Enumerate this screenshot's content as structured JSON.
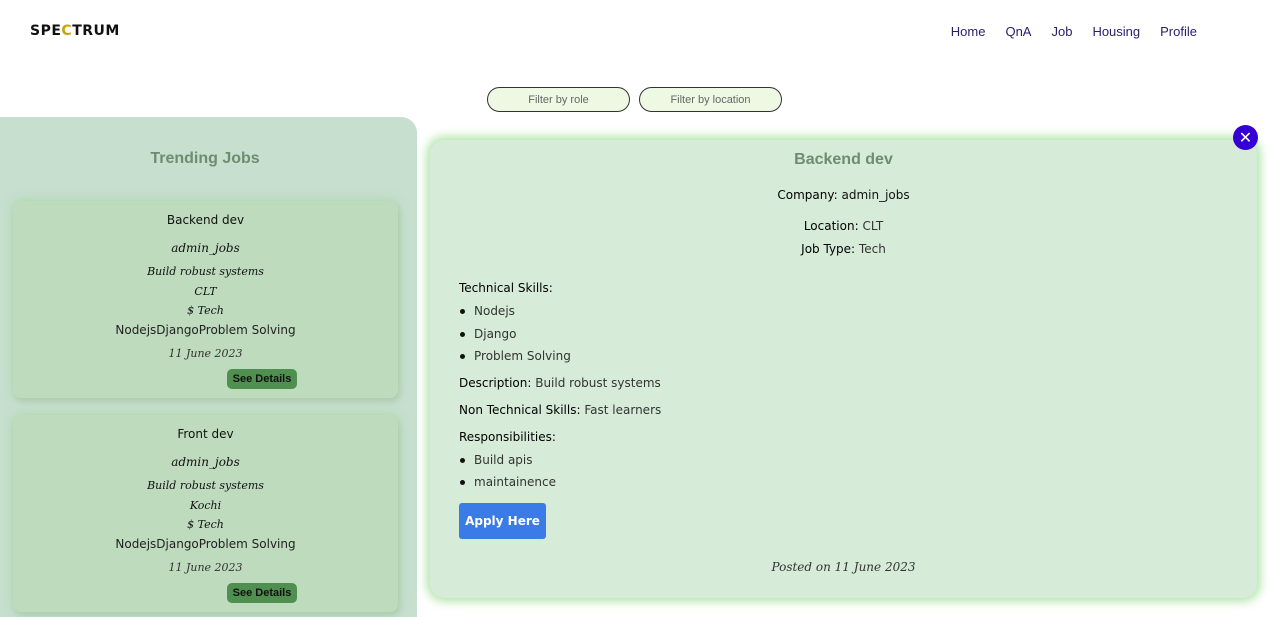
{
  "header": {
    "logo_pre": "SPE",
    "logo_mark": "C",
    "logo_post": "TRUM",
    "nav": [
      "Home",
      "QnA",
      "Job",
      "Housing",
      "Profile"
    ]
  },
  "filters": {
    "role_placeholder": "Filter by role",
    "location_placeholder": "Filter by location"
  },
  "sidebar": {
    "title": "Trending Jobs",
    "cards": [
      {
        "title": "Backend dev",
        "company": "admin_jobs",
        "description": "Build robust systems",
        "location": "CLT",
        "type": "$ Tech",
        "skills": "NodejsDjangoProblem Solving",
        "date": "11 June 2023",
        "button": "See Details"
      },
      {
        "title": "Front dev",
        "company": "admin_jobs",
        "description": "Build robust systems",
        "location": "Kochi",
        "type": "$ Tech",
        "skills": "NodejsDjangoProblem Solving",
        "date": "11 June 2023",
        "button": "See Details"
      }
    ]
  },
  "detail": {
    "close_icon": "close-icon",
    "title": "Backend dev",
    "company_label": "Company:",
    "company": "admin_jobs",
    "location_label": "Location:",
    "location": "CLT",
    "job_type_label": "Job Type:",
    "job_type": "Tech",
    "tech_skills_label": "Technical Skills:",
    "tech_skills": [
      "Nodejs",
      "Django",
      "Problem Solving"
    ],
    "description_label": "Description:",
    "description": "Build robust systems",
    "non_tech_label": "Non Technical Skills:",
    "non_tech": "Fast learners",
    "responsibilities_label": "Responsibilities:",
    "responsibilities": [
      "Build apis",
      "maintainence"
    ],
    "apply_label": "Apply Here",
    "posted": "Posted on 11 June 2023"
  },
  "colors": {
    "accent": "#3a7be8",
    "close": "#3500d6",
    "sidebar_bg": "#c6dfcf",
    "card_bg": "#bedbbd",
    "detail_bg": "#d6ebd8"
  }
}
